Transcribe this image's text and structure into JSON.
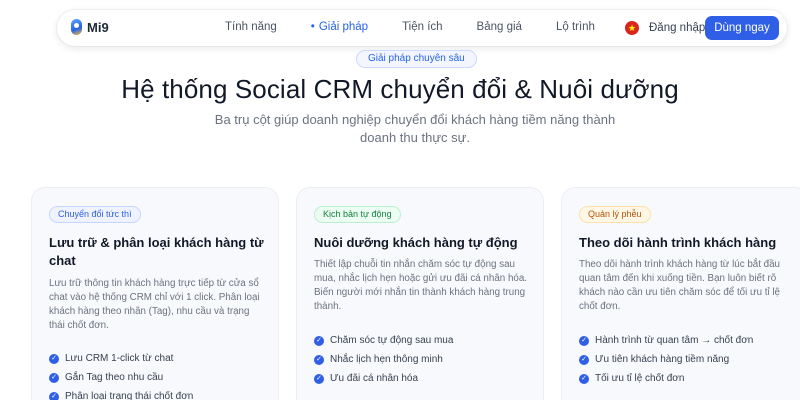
{
  "nav": {
    "brand": "Mi9",
    "links": [
      "Tính năng",
      "Giải pháp",
      "Tiện ích",
      "Bảng giá",
      "Lộ trình"
    ],
    "active_index": 1,
    "login": "Đăng nhập",
    "cta": "Dùng ngay"
  },
  "hero": {
    "eyebrow": "Giải pháp chuyên sâu",
    "title": "Hệ thống Social CRM chuyển đổi & Nuôi dưỡng",
    "subtitle": "Ba trụ cột giúp doanh nghiệp chuyển đổi khách hàng tiềm năng thành doanh thu thực sự."
  },
  "cards": [
    {
      "badge": "Chuyển đổi tức thì",
      "badge_color": "#2f5fe6",
      "title": "Lưu trữ & phân loại khách hàng từ chat",
      "desc": "Lưu trữ thông tin khách hàng trực tiếp từ cửa sổ chat vào hệ thống CRM chỉ với 1 click. Phân loại khách hàng theo nhãn (Tag), nhu cầu và trạng thái chốt đơn.",
      "features": [
        "Lưu CRM 1-click từ chat",
        "Gắn Tag theo nhu cầu",
        "Phân loại trạng thái chốt đơn"
      ]
    },
    {
      "badge": "Kịch bản tự động",
      "badge_color": "#15803d",
      "title": "Nuôi dưỡng khách hàng tự động",
      "desc": "Thiết lập chuỗi tin nhắn chăm sóc tự động sau mua, nhắc lịch hẹn hoặc gửi ưu đãi cá nhân hóa. Biến người mới nhắn tin thành khách hàng trung thành.",
      "features": [
        "Chăm sóc tự động sau mua",
        "Nhắc lịch hẹn thông minh",
        "Ưu đãi cá nhân hóa"
      ]
    },
    {
      "badge": "Quản lý phễu",
      "badge_color": "#b45309",
      "title": "Theo dõi hành trình khách hàng",
      "desc": "Theo dõi hành trình khách hàng từ lúc bắt đầu quan tâm đến khi xuống tiền. Bạn luôn biết rõ khách nào cần ưu tiên chăm sóc để tối ưu tỉ lệ chốt đơn.",
      "features": [
        "Hành trình từ quan tâm → chốt đơn",
        "Ưu tiên khách hàng tiềm năng",
        "Tối ưu tỉ lệ chốt đơn"
      ]
    }
  ],
  "colors": {
    "primary": "#2f5fe6",
    "heading": "#111827",
    "muted": "#6b7280"
  },
  "icons": {
    "check": "check-circle-icon",
    "flag": "vietnam-flag-icon",
    "logo": "mi9-logo-icon"
  }
}
